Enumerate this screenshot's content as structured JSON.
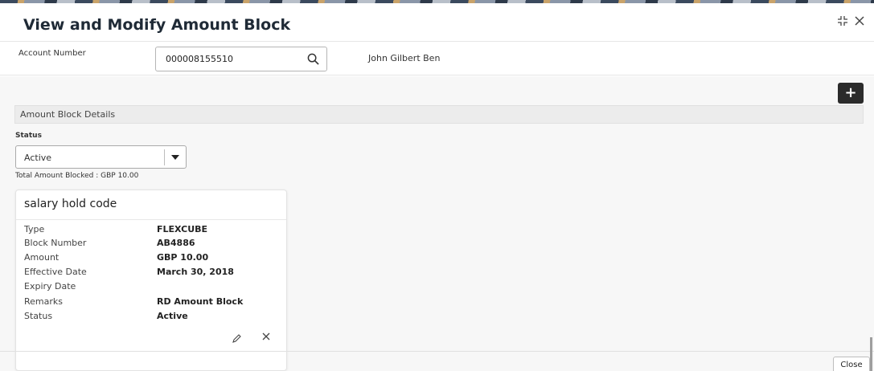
{
  "window": {
    "title": "View and Modify Amount Block",
    "minimize_icon": "collapse-icon",
    "close_icon": "close-icon"
  },
  "account": {
    "label": "Account Number",
    "value": "000008155510",
    "customer_name": "John Gilbert Ben"
  },
  "actions": {
    "add_icon": "+"
  },
  "section": {
    "title": "Amount Block Details",
    "status_label": "Status",
    "status_value": "Active",
    "total_blocked": "Total Amount Blocked : GBP 10.00"
  },
  "card": {
    "title": "salary hold code",
    "fields": [
      {
        "label": "Type",
        "value": "FLEXCUBE"
      },
      {
        "label": "Block Number",
        "value": "AB4886"
      },
      {
        "label": "Amount",
        "value": "GBP 10.00"
      },
      {
        "label": "Effective Date",
        "value": "March 30, 2018"
      },
      {
        "label": "Expiry Date",
        "value": ""
      },
      {
        "label": "Remarks",
        "value": "RD Amount Block"
      },
      {
        "label": "Status",
        "value": "Active"
      }
    ]
  },
  "footer": {
    "close_label": "Close"
  }
}
